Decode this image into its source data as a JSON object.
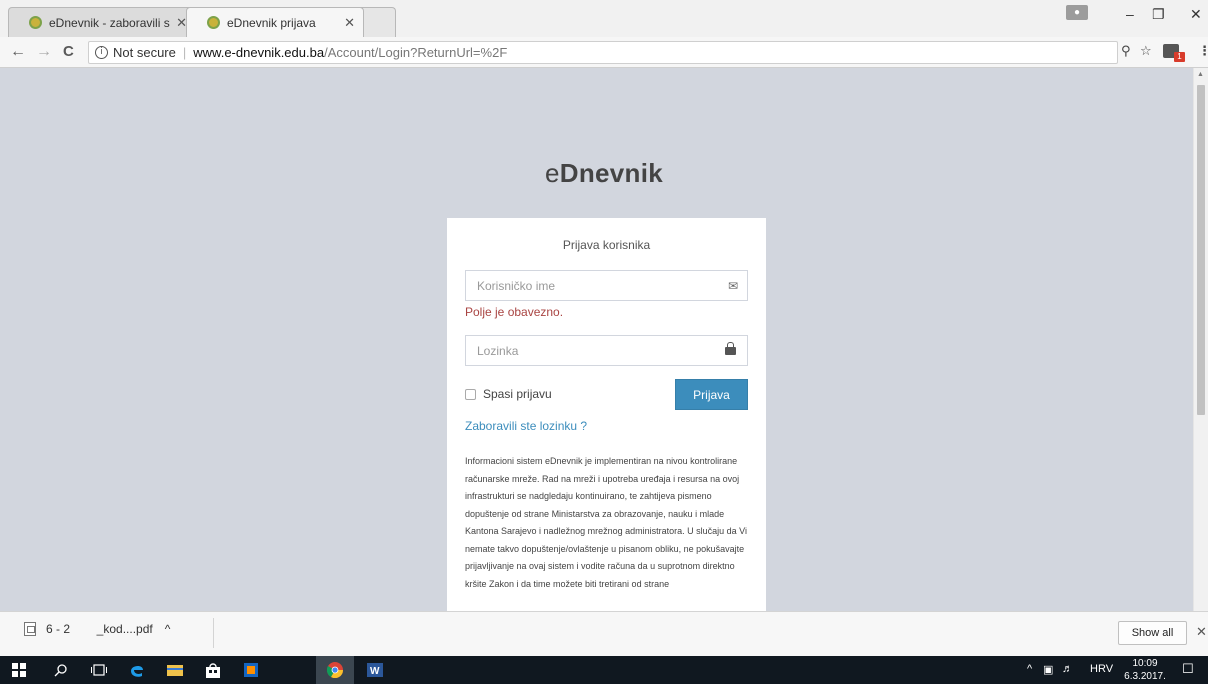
{
  "browser": {
    "tabs": [
      {
        "title": "eDnevnik - zaboravili ste",
        "close": "✕",
        "active": false
      },
      {
        "title": "eDnevnik prijava",
        "close": "✕",
        "active": true
      }
    ],
    "window_controls": {
      "minimize": "–",
      "restore": "❐",
      "close": "✕"
    },
    "nav": {
      "back": "←",
      "forward": "→",
      "reload": "C"
    },
    "address": {
      "info": "i",
      "security_label": "Not secure",
      "host": "www.e-dnevnik.edu.ba",
      "path": "/Account/Login?ReturnUrl=%2F"
    },
    "ext_badge": "1"
  },
  "page": {
    "logo_prefix": "e",
    "logo_bold": "Dnevnik",
    "box_title": "Prijava korisnika",
    "username_placeholder": "Korisničko ime",
    "username_error": "Polje je obavezno.",
    "password_placeholder": "Lozinka",
    "remember_label": "Spasi prijavu",
    "login_button": "Prijava",
    "forgot_link": "Zaboravili ste lozinku ?",
    "notice": "Informacioni sistem eDnevnik je implementiran na nivou kontrolirane računarske mreže. Rad na mreži i upotreba uređaja i resursa na ovoj infrastrukturi se nadgledaju kontinuirano, te zahtijeva pismeno dopuštenje od strane Ministarstva za obrazovanje, nauku i mlade Kantona Sarajevo i nadležnog mrežnog administratora. U slučaju da Vi nemate takvo dopuštenje/ovlaštenje u pisanom obliku, ne pokušavajte prijavljivanje na ovaj sistem i vodite računa da u suprotnom direktno kršite Zakon i da time možete biti tretirani od strane"
  },
  "downloads": {
    "file_name": "6 - 2        _kod....pdf",
    "chevron": "^",
    "show_all": "Show all",
    "close": "✕"
  },
  "taskbar": {
    "tray_chevron": "^",
    "lang": "HRV",
    "time": "10:09",
    "date": "6.3.2017."
  },
  "colors": {
    "page_bg": "#d2d6de",
    "primary": "#3c8dbc",
    "error": "#a94442",
    "taskbar": "#101820"
  }
}
